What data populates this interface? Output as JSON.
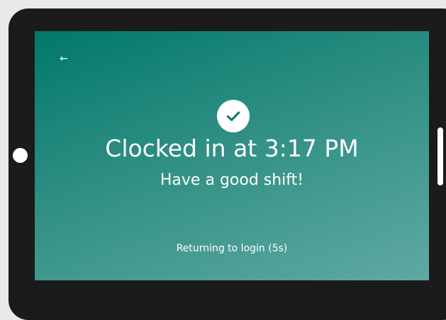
{
  "screen": {
    "back_icon": "←",
    "status_icon": "check-icon",
    "title": "Clocked in at 3:17 PM",
    "subtitle": "Have a good shift!",
    "countdown": "Returning to login (5s)"
  },
  "colors": {
    "gradient_start": "#00796b",
    "gradient_end": "#5fa9a3",
    "check_color": "#1f7a6d",
    "device_frame": "#1b1b1c"
  }
}
